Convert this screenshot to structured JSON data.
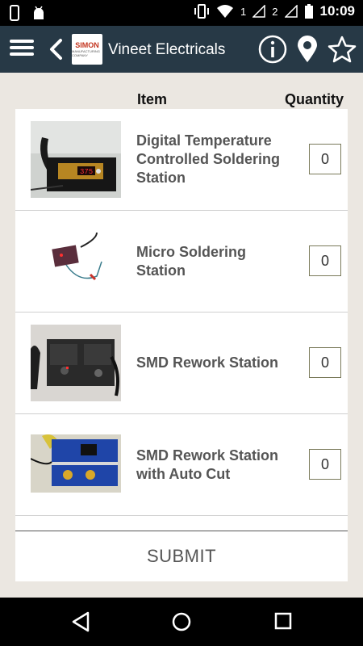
{
  "status_bar": {
    "time": "10:09",
    "sim1": "1",
    "sim2": "2"
  },
  "app_bar": {
    "title": "Vineet Electricals",
    "logo_text": "SIMON",
    "logo_subtext": "MANUFACTURING COMPANY"
  },
  "table": {
    "col_item": "Item",
    "col_quantity": "Quantity"
  },
  "items": [
    {
      "name": "Digital Temperature Controlled Soldering Station",
      "qty": "0",
      "display": "375"
    },
    {
      "name": "Micro Soldering Station",
      "qty": "0"
    },
    {
      "name": "SMD Rework Station",
      "qty": "0"
    },
    {
      "name": "SMD Rework Station with Auto Cut",
      "qty": "0"
    }
  ],
  "submit_label": "SUBMIT",
  "colors": {
    "app_bar": "#273946",
    "background": "#ebe7e1"
  }
}
